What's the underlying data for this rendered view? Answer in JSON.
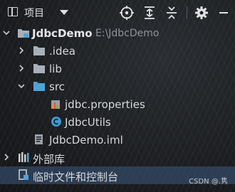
{
  "toolbar": {
    "view_title": "项目",
    "icons": [
      "locate-icon",
      "expand-all-icon",
      "collapse-all-icon",
      "gear-icon",
      "minimize-icon"
    ]
  },
  "tree": {
    "root": {
      "name": "JdbcDemo",
      "path": "E:\\JdbcDemo"
    },
    "idea": "idea",
    "idea_prefix": ".",
    "lib": "lib",
    "src": "src",
    "properties_file": "jdbc.properties",
    "utils_class": "JdbcUtils",
    "iml_file": "JdbcDemo.iml",
    "external_libs": "外部库",
    "scratches": "临时文件和控制台"
  },
  "watermark": "CSDN @.隽",
  "colors": {
    "folder": "#aab0b8",
    "source_folder": "#4fa3d6",
    "class_icon": "#3d9ccf",
    "selection": "#3d5980"
  }
}
